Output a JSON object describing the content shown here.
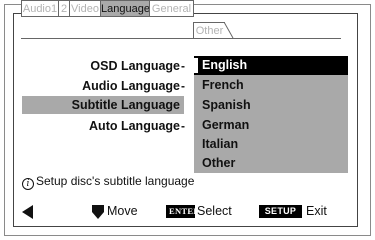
{
  "tabs": [
    {
      "label": "Audio1",
      "active": false
    },
    {
      "label": "2",
      "active": false
    },
    {
      "label": "Video",
      "active": false
    },
    {
      "label": "Language",
      "active": true
    },
    {
      "label": "General",
      "active": false
    },
    {
      "label": "Other",
      "active": false
    }
  ],
  "settings": [
    {
      "label": "OSD Language",
      "highlighted": false
    },
    {
      "label": "Audio Language",
      "highlighted": false
    },
    {
      "label": "Subtitle Language",
      "highlighted": true
    },
    {
      "label": "Auto Language",
      "highlighted": false
    }
  ],
  "options": [
    {
      "label": "English",
      "selected": true
    },
    {
      "label": "French",
      "selected": false
    },
    {
      "label": "Spanish",
      "selected": false
    },
    {
      "label": "German",
      "selected": false
    },
    {
      "label": "Italian",
      "selected": false
    },
    {
      "label": "Other",
      "selected": false
    }
  ],
  "help": {
    "text": "Setup disc's subtitle language",
    "icon": "info-icon"
  },
  "footer": {
    "move_label": "Move",
    "enter_key": "ENTER",
    "select_label": "Select",
    "setup_key": "SETUP",
    "exit_label": "Exit"
  },
  "colors": {
    "highlight": "#a9a9a9",
    "selected_bg": "#000000",
    "selected_text": "#ffffff",
    "inactive_tab_text": "#b3b3b3"
  }
}
